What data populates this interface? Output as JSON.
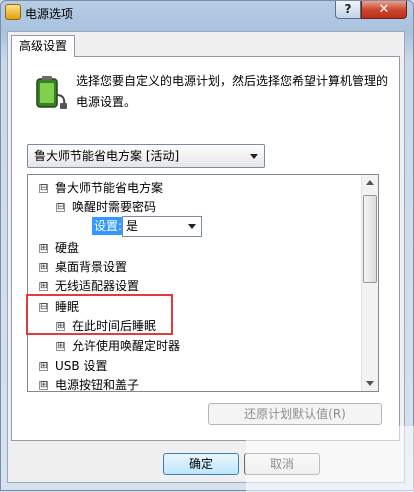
{
  "window": {
    "title": "电源选项",
    "help_glyph": "?",
    "close_glyph": "✕"
  },
  "tab": {
    "label": "高级设置"
  },
  "description": "选择您要自定义的电源计划，然后选择您希望计算机管理的电源设置。",
  "plan_select": {
    "value": "鲁大师节能省电方案 [活动]"
  },
  "tree": {
    "items": [
      {
        "label": "鲁大师节能省电方案",
        "expander": "⊟"
      },
      {
        "label": "唤醒时需要密码",
        "expander": "⊟"
      },
      {
        "label": "硬盘",
        "expander": "⊞"
      },
      {
        "label": "桌面背景设置",
        "expander": "⊞"
      },
      {
        "label": "无线适配器设置",
        "expander": "⊞"
      },
      {
        "label": "睡眠",
        "expander": "⊟"
      },
      {
        "label": "在此时间后睡眠",
        "expander": "⊞"
      },
      {
        "label": "允许使用唤醒定时器",
        "expander": "⊞"
      },
      {
        "label": "USB 设置",
        "expander": "⊞"
      },
      {
        "label": "电源按钮和盖子",
        "expander": "⊞"
      }
    ],
    "setting": {
      "label": "设置:",
      "value": "是"
    }
  },
  "buttons": {
    "restore_defaults": "还原计划默认值(R)",
    "ok": "确定",
    "cancel": "取消"
  },
  "colors": {
    "highlight": "#3399ff",
    "annotation_box": "#e23b3b"
  }
}
